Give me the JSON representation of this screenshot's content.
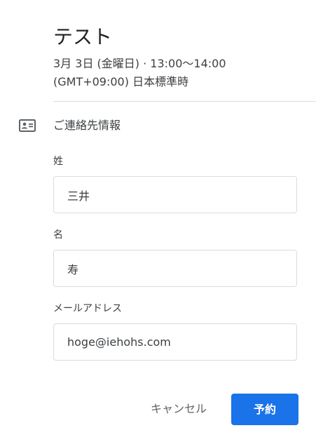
{
  "event": {
    "title": "テスト",
    "datetime": "3月 3日 (金曜日) · 13:00～14:00",
    "timezone": "(GMT+09:00) 日本標準時"
  },
  "contact_section": {
    "icon": "contact-card-icon",
    "title": "ご連絡先情報"
  },
  "form": {
    "last_name": {
      "label": "姓",
      "value": "三井"
    },
    "first_name": {
      "label": "名",
      "value": "寿"
    },
    "email": {
      "label": "メールアドレス",
      "value": "hoge@iehohs.com"
    }
  },
  "actions": {
    "cancel_label": "キャンセル",
    "submit_label": "予約"
  },
  "colors": {
    "primary": "#1a73e8",
    "text": "#202124",
    "secondary_text": "#3c4043",
    "border": "#dadce0"
  }
}
